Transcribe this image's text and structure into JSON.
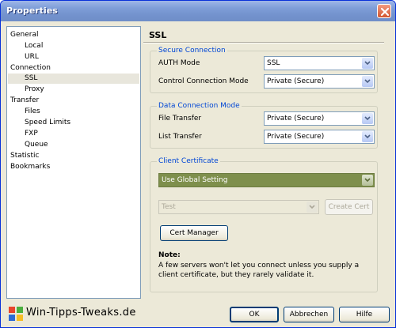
{
  "window": {
    "title": "Properties"
  },
  "tree": {
    "items": [
      {
        "label": "General",
        "level": 0
      },
      {
        "label": "Local",
        "level": 1
      },
      {
        "label": "URL",
        "level": 1
      },
      {
        "label": "Connection",
        "level": 0
      },
      {
        "label": "SSL",
        "level": 1,
        "selected": true
      },
      {
        "label": "Proxy",
        "level": 1
      },
      {
        "label": "Transfer",
        "level": 0
      },
      {
        "label": "Files",
        "level": 1
      },
      {
        "label": "Speed Limits",
        "level": 1
      },
      {
        "label": "FXP",
        "level": 1
      },
      {
        "label": "Queue",
        "level": 1
      },
      {
        "label": "Statistic",
        "level": 0
      },
      {
        "label": "Bookmarks",
        "level": 0
      }
    ]
  },
  "panel": {
    "title": "SSL",
    "secure_connection": {
      "legend": "Secure Connection",
      "auth_mode_label": "AUTH Mode",
      "auth_mode_value": "SSL",
      "control_mode_label": "Control Connection Mode",
      "control_mode_value": "Private (Secure)"
    },
    "data_connection": {
      "legend": "Data Connection Mode",
      "file_transfer_label": "File Transfer",
      "file_transfer_value": "Private (Secure)",
      "list_transfer_label": "List Transfer",
      "list_transfer_value": "Private (Secure)"
    },
    "client_certificate": {
      "legend": "Client Certificate",
      "setting_value": "Use Global Setting",
      "cert_value": "Test",
      "create_cert_label": "Create Cert",
      "cert_manager_label": "Cert Manager",
      "note_title": "Note:",
      "note_text": "A few servers won't let you connect unless you supply a client certificate, but they rarely validate it."
    }
  },
  "footer": {
    "brand": "Win-Tipps-Tweaks.de",
    "ok_label": "OK",
    "cancel_label": "Abbrechen",
    "help_label": "Hilfe"
  },
  "colors": {
    "titlebar": "#7f9ed8",
    "legend_text": "#0046d5",
    "selected_combo": "#7e8f4c"
  }
}
